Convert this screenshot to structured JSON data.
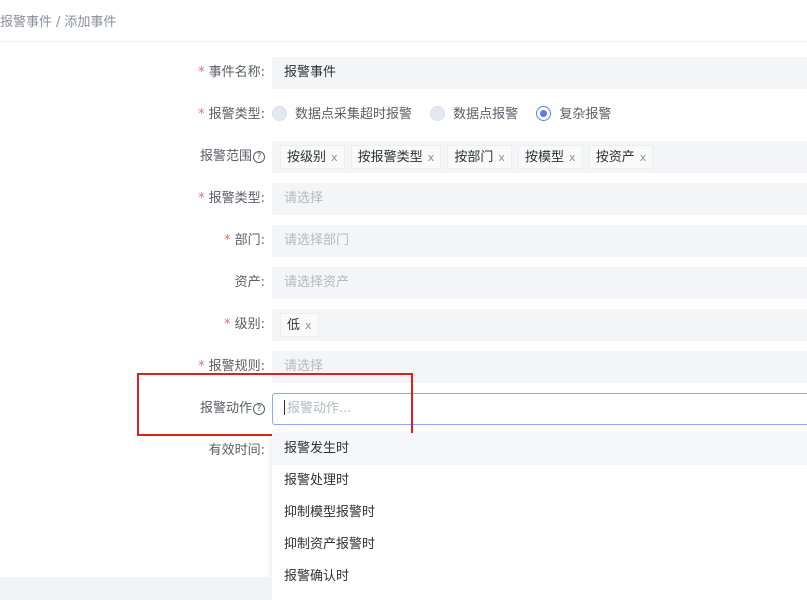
{
  "breadcrumb": {
    "parent": "报警事件",
    "separator": "/",
    "current": "添加事件"
  },
  "form": {
    "event_name": {
      "label": "事件名称:",
      "required": "*",
      "value": "报警事件"
    },
    "alarm_kind": {
      "label": "报警类型:",
      "required": "*",
      "options": [
        "数据点采集超时报警",
        "数据点报警",
        "复杂报警"
      ],
      "selected": "复杂报警"
    },
    "alarm_scope": {
      "label": "报警范围",
      "help_icon": "?",
      "tags": [
        "按级别",
        "按报警类型",
        "按部门",
        "按模型",
        "按资产"
      ],
      "remove_icon": "x"
    },
    "alarm_type_select": {
      "label": "报警类型:",
      "required": "*",
      "placeholder": "请选择"
    },
    "department": {
      "label": "部门:",
      "required": "*",
      "placeholder": "请选择部门"
    },
    "asset": {
      "label": "资产:",
      "placeholder": "请选择资产"
    },
    "level": {
      "label": "级别:",
      "required": "*",
      "tags": [
        "低"
      ],
      "remove_icon": "x"
    },
    "alarm_rule": {
      "label": "报警规则:",
      "required": "*",
      "placeholder": "请选择"
    },
    "alarm_action": {
      "label": "报警动作",
      "help_icon": "?",
      "placeholder": "报警动作..."
    },
    "valid_time": {
      "label": "有效时间:"
    }
  },
  "dropdown": {
    "items": [
      "报警发生时",
      "报警处理时",
      "抑制模型报警时",
      "抑制资产报警时",
      "报警确认时"
    ],
    "active_index": 0
  },
  "colors": {
    "accent": "#5b7cf6",
    "required": "#f56c6c",
    "highlight_box": "#e02020"
  }
}
